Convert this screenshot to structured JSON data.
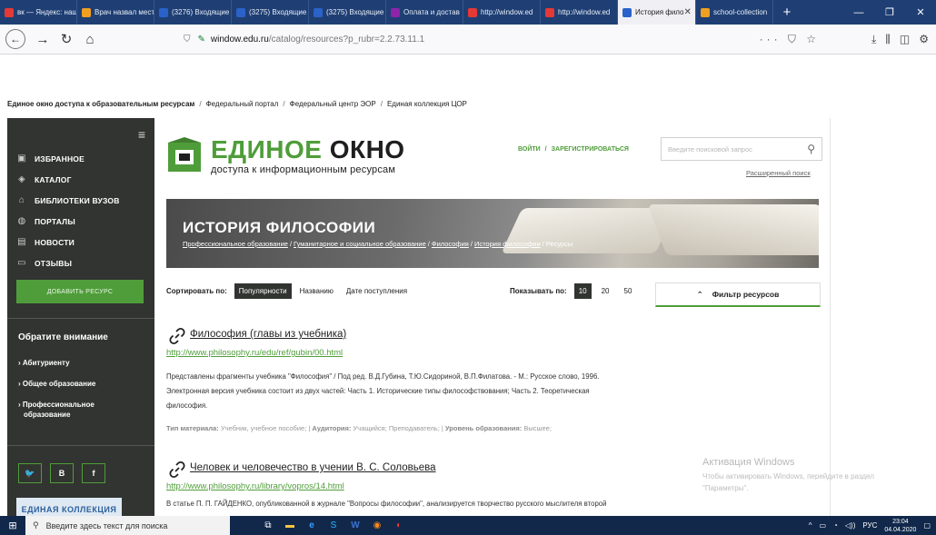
{
  "browser": {
    "tabs": [
      {
        "label": "вк — Яндекс: нашл",
        "color": "#e53935"
      },
      {
        "label": "Врач назвал мест",
        "color": "#f0a020"
      },
      {
        "label": "(3276) Входящие",
        "color": "#2a62c9"
      },
      {
        "label": "(3275) Входящие",
        "color": "#2a62c9"
      },
      {
        "label": "(3275) Входящие",
        "color": "#2a62c9"
      },
      {
        "label": "Оплата и достав",
        "color": "#8e24aa"
      },
      {
        "label": "http://window.ed",
        "color": "#e53935"
      },
      {
        "label": "http://window.ed",
        "color": "#e53935"
      },
      {
        "label": "История фило",
        "color": "#2a62c9",
        "active": true
      },
      {
        "label": "school-collection",
        "color": "#f0a020"
      }
    ],
    "new_tab": "+",
    "url_domain": "window.edu.ru",
    "url_path": "/catalog/resources?p_rubr=2.2.73.11.1",
    "url_actions": "··· ⛉ ☆"
  },
  "breadcrumbs": {
    "main": "Единое окно доступа к образовательным ресурсам",
    "items": [
      "Федеральный портал",
      "Федеральный центр ЭОР",
      "Единая коллекция ЦОР"
    ],
    "sep": "/"
  },
  "sidebar": {
    "menu": [
      {
        "label": "ИЗБРАННОЕ",
        "icon": "▣"
      },
      {
        "label": "КАТАЛОГ",
        "icon": "◈"
      },
      {
        "label": "БИБЛИОТЕКИ ВУЗОВ",
        "icon": "⌂"
      },
      {
        "label": "ПОРТАЛЫ",
        "icon": "◍"
      },
      {
        "label": "НОВОСТИ",
        "icon": "▤"
      },
      {
        "label": "ОТЗЫВЫ",
        "icon": "▭"
      }
    ],
    "add_resource": "ДОБАВИТЬ РЕСУРС",
    "attention_title": "Обратите внимание",
    "attention_links": [
      "› Абитуриенту",
      "› Общее образование",
      "› Профессиональное",
      "образование"
    ],
    "social": [
      "🐦",
      "B",
      "f"
    ],
    "collection_logo": "ЕДИНАЯ КОЛЛЕКЦИЯ"
  },
  "header": {
    "logo_word1": "ЕДИНОЕ",
    "logo_word2": "ОКНО",
    "logo_sub": "доступа к информационным ресурсам",
    "login": "ВОЙТИ",
    "auth_sep": "/",
    "register": "ЗАРЕГИСТРИРОВАТЬСЯ",
    "search_placeholder": "Введите поисковой запрос",
    "advanced_search": "Расширенный поиск"
  },
  "banner": {
    "title": "ИСТОРИЯ ФИЛОСОФИИ",
    "crumbs": [
      "Профессиональное образование",
      "Гуманитарное и социальное образование",
      "Философия",
      "История философии"
    ],
    "current": "Ресурсы"
  },
  "sort": {
    "label": "Сортировать по:",
    "options": [
      "Популярности",
      "Названию",
      "Дате поступления"
    ],
    "selected": 0
  },
  "show": {
    "label": "Показывать по:",
    "options": [
      "10",
      "20",
      "50"
    ],
    "selected": 0
  },
  "filter": {
    "label": "Фильтр ресурсов"
  },
  "results": [
    {
      "title": "Философия (главы из учебника)",
      "url": "http://www.philosophy.ru/edu/ref/gubin/00.html",
      "desc1": "Представлены фрагменты учебника \"Философия\" / Под ред. В.Д.Губина, Т.Ю.Сидориной, В.П.Филатова. - М.: Русское слово, 1996.",
      "desc2": "Электронная версия учебника состоит из двух частей: Часть 1. Исторические типы философствования; Часть 2. Теоретическая",
      "desc3": "философия.",
      "meta_type_label": "Тип материала:",
      "meta_type": "Учебник, учебное пособие;",
      "meta_aud_label": "Аудитория:",
      "meta_aud": "Учащийся; Преподаватель;",
      "meta_lvl_label": "Уровень образования:",
      "meta_lvl": "Высшее;"
    },
    {
      "title": "Человек и человечество в учении В. С. Соловьева",
      "url": "http://www.philosophy.ru/library/vopros/14.html",
      "desc1": "В статье П. П. ГАЙДЕНКО, опубликованной в журнале \"Вопросы философии\", анализируется творчество русского мыслителя второй"
    }
  ],
  "watermark": {
    "title": "Активация Windows",
    "text": "Чтобы активировать Windows, перейдите в раздел \"Параметры\"."
  },
  "taskbar": {
    "search": "Введите здесь текст для поиска",
    "lang": "РУС",
    "time": "23:04",
    "date": "04.04.2020"
  }
}
